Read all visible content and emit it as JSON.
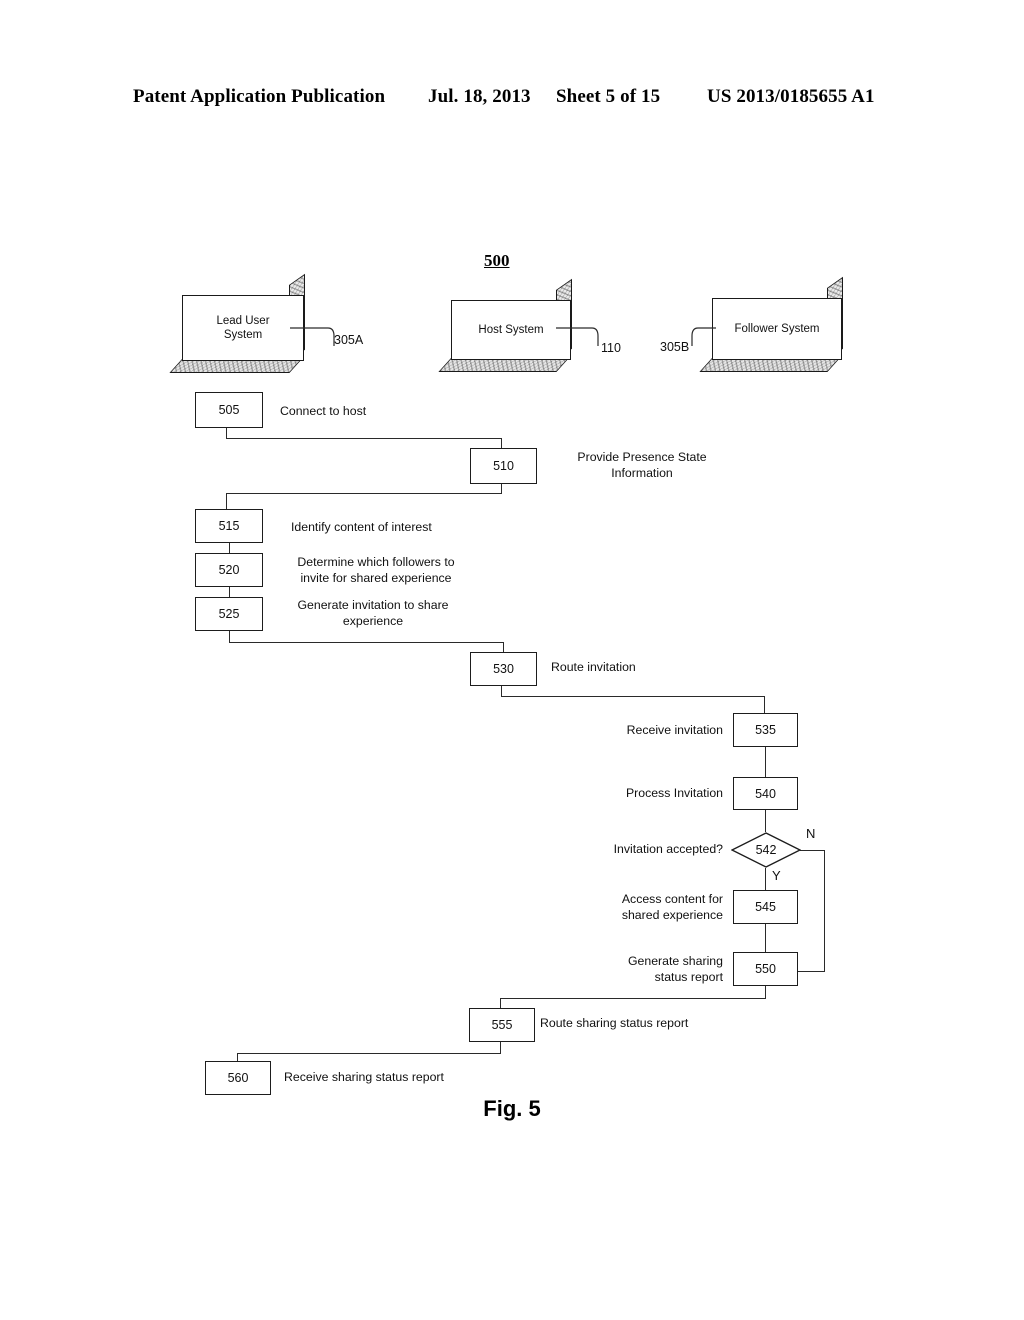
{
  "header": {
    "publication": "Patent Application Publication",
    "date": "Jul. 18, 2013",
    "sheet": "Sheet 5 of 15",
    "number": "US 2013/0185655 A1"
  },
  "figure": {
    "reference_number": "500",
    "caption": "Fig. 5"
  },
  "systems": [
    {
      "label": "Lead User\nSystem",
      "ref": "305A"
    },
    {
      "label": "Host System",
      "ref": "110"
    },
    {
      "label": "Follower System",
      "ref": "305B"
    }
  ],
  "steps": [
    {
      "ref": "505",
      "text": "Connect to host",
      "lane": "lead"
    },
    {
      "ref": "510",
      "text": "Provide Presence State\nInformation",
      "lane": "host"
    },
    {
      "ref": "515",
      "text": "Identify content of interest",
      "lane": "lead"
    },
    {
      "ref": "520",
      "text": "Determine which followers to\ninvite for shared experience",
      "lane": "lead"
    },
    {
      "ref": "525",
      "text": "Generate invitation to share\nexperience",
      "lane": "lead"
    },
    {
      "ref": "530",
      "text": "Route invitation",
      "lane": "host"
    },
    {
      "ref": "535",
      "text": "Receive invitation",
      "lane": "follower"
    },
    {
      "ref": "540",
      "text": "Process Invitation",
      "lane": "follower"
    },
    {
      "ref": "542",
      "text": "Invitation accepted?",
      "lane": "follower",
      "shape": "decision"
    },
    {
      "ref": "545",
      "text": "Access content for\nshared experience",
      "lane": "follower"
    },
    {
      "ref": "550",
      "text": "Generate sharing\nstatus report",
      "lane": "follower"
    },
    {
      "ref": "555",
      "text": "Route sharing status report",
      "lane": "host"
    },
    {
      "ref": "560",
      "text": "Receive sharing status report",
      "lane": "lead"
    }
  ],
  "branches": {
    "yes": "Y",
    "no": "N"
  },
  "colors": {
    "line": "#2a2a2a",
    "text": "#111111",
    "background": "#ffffff"
  }
}
